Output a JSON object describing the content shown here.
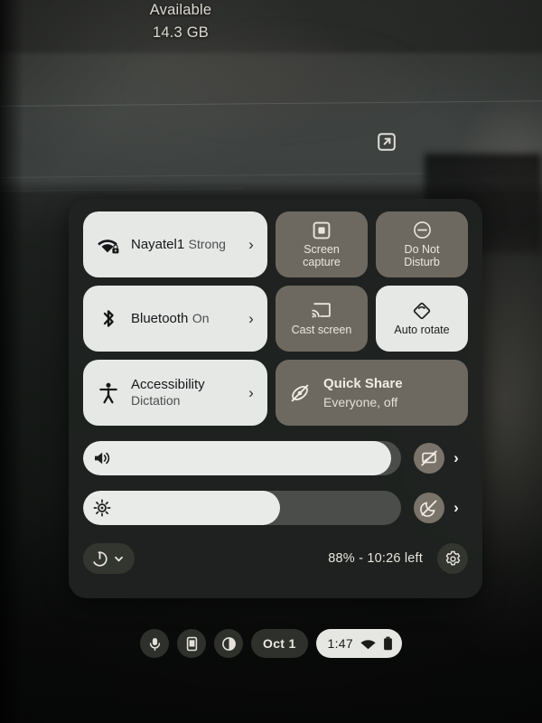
{
  "storage": {
    "label": "Available",
    "value": "14.3 GB"
  },
  "desktop": {
    "external_link_icon": "external-link-icon"
  },
  "quick_settings": {
    "pods": [
      {
        "id": "network",
        "icon": "wifi-locked-icon",
        "title": "Nayatel1",
        "subtitle": "Strong",
        "chevron": "›"
      },
      {
        "id": "bluetooth",
        "icon": "bluetooth-icon",
        "title": "Bluetooth",
        "subtitle": "On",
        "chevron": "›"
      },
      {
        "id": "accessibility",
        "icon": "accessibility-icon",
        "title": "Accessibility",
        "subtitle": "Dictation",
        "chevron": "›"
      }
    ],
    "tiles": [
      {
        "id": "screen-capture",
        "icon": "screen-capture-icon",
        "label": "Screen\ncapture",
        "label_line1": "Screen",
        "label_line2": "capture",
        "state": "off"
      },
      {
        "id": "do-not-disturb",
        "icon": "do-not-disturb-icon",
        "label_line1": "Do Not",
        "label_line2": "Disturb",
        "state": "off"
      },
      {
        "id": "cast-screen",
        "icon": "cast-icon",
        "label_line1": "Cast screen",
        "label_line2": "",
        "state": "off"
      },
      {
        "id": "auto-rotate",
        "icon": "auto-rotate-icon",
        "label_line1": "Auto rotate",
        "label_line2": "",
        "state": "on"
      }
    ],
    "quick_share": {
      "icon": "quick-share-off-icon",
      "title": "Quick Share",
      "subtitle": "Everyone, off"
    },
    "sliders": [
      {
        "id": "volume",
        "icon": "volume-on-icon",
        "value": 97,
        "toggle_icon": "mic-muted-icon",
        "chevron": "›"
      },
      {
        "id": "brightness",
        "icon": "brightness-icon",
        "value": 62,
        "toggle_icon": "night-light-off-icon",
        "chevron": "›"
      }
    ],
    "footer": {
      "power_icon": "power-icon",
      "power_chevron_icon": "chevron-down-icon",
      "battery_status": "88% - 10:26 left",
      "settings_icon": "gear-icon"
    }
  },
  "shelf": {
    "buttons": [
      {
        "id": "dictation",
        "icon": "microphone-icon"
      },
      {
        "id": "phone-hub",
        "icon": "phone-icon"
      },
      {
        "id": "notifications",
        "icon": "contrast-circle-icon"
      }
    ],
    "date": "Oct 1",
    "status": {
      "time": "1:47",
      "network_icon": "wifi-icon",
      "battery_icon": "battery-icon"
    }
  },
  "colors": {
    "panel_bg": "#1f2220",
    "tile_active": "#e6e8e6",
    "tile_inactive": "#6e6960",
    "slider_track": "#4a4d49",
    "slider_fill": "#e9ebe9",
    "text_light": "#eae6de",
    "text_dark": "#15171a"
  }
}
